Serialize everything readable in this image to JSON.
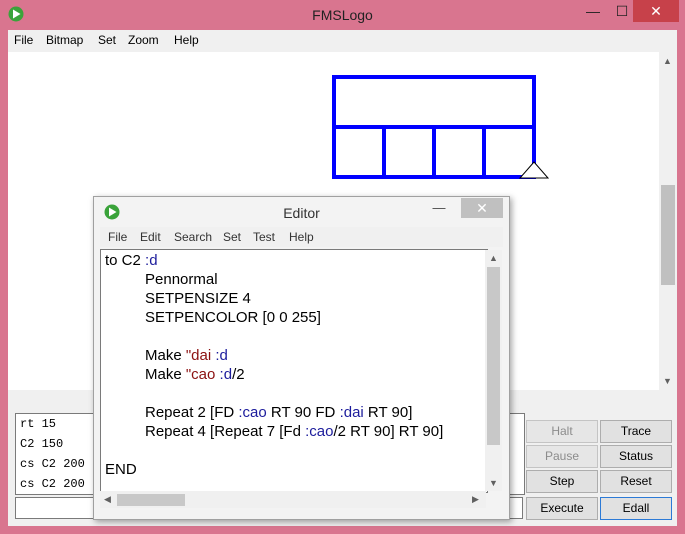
{
  "main_window": {
    "title": "FMSLogo",
    "minimize": "—",
    "maximize": "☐",
    "close": "✕",
    "menu": [
      "File",
      "Bitmap",
      "Set",
      "Zoom",
      "Help"
    ]
  },
  "history": [
    "rt 15",
    "C2 150",
    "cs C2 200",
    "cs C2 200"
  ],
  "command_input": {
    "value": ""
  },
  "buttons": {
    "halt": "Halt",
    "trace": "Trace",
    "pause": "Pause",
    "status": "Status",
    "step": "Step",
    "reset": "Reset",
    "execute": "Execute",
    "edall": "Edall"
  },
  "editor": {
    "title": "Editor",
    "minimize": "—",
    "close": "✕",
    "menu": [
      "File",
      "Edit",
      "Search",
      "Set",
      "Test",
      "Help"
    ],
    "code": {
      "l1_a": "to C2 ",
      "l1_b": ":d",
      "l2": "Pennormal",
      "l3": "SETPENSIZE 4",
      "l4": "SETPENCOLOR [0 0 255]",
      "l5_a": "Make ",
      "l5_b": "\"dai",
      "l5_c": " ",
      "l5_d": ":d",
      "l6_a": "Make ",
      "l6_b": "\"cao",
      "l6_c": " ",
      "l6_d": ":d",
      "l6_e": "/2",
      "l7_a": "Repeat 2 [FD ",
      "l7_b": ":cao",
      "l7_c": " RT 90 FD ",
      "l7_d": ":dai",
      "l7_e": " RT 90]",
      "l8_a": "Repeat 4 [Repeat 7 [Fd ",
      "l8_b": ":cao",
      "l8_c": "/2 RT 90] RT 90]",
      "l9": "END"
    }
  },
  "colors": {
    "titlebar": "#d9758f",
    "drawing": "#0000ff",
    "keyword": "#1c1c9c",
    "string": "#8b1010"
  }
}
